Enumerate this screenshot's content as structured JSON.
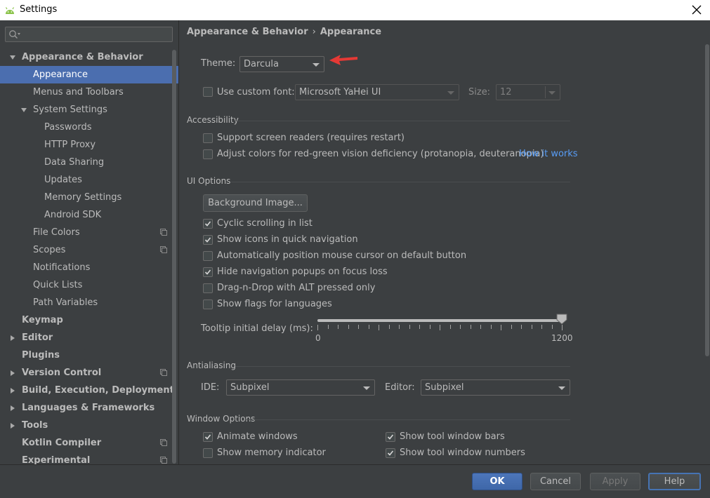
{
  "window": {
    "title": "Settings"
  },
  "sidebar": {
    "items": [
      {
        "label": "Appearance & Behavior",
        "level": 0,
        "bold": true,
        "expanded": true
      },
      {
        "label": "Appearance",
        "level": 1,
        "selected": true
      },
      {
        "label": "Menus and Toolbars",
        "level": 1
      },
      {
        "label": "System Settings",
        "level": 1,
        "expanded": true
      },
      {
        "label": "Passwords",
        "level": 2
      },
      {
        "label": "HTTP Proxy",
        "level": 2
      },
      {
        "label": "Data Sharing",
        "level": 2
      },
      {
        "label": "Updates",
        "level": 2
      },
      {
        "label": "Memory Settings",
        "level": 2
      },
      {
        "label": "Android SDK",
        "level": 2
      },
      {
        "label": "File Colors",
        "level": 1,
        "project_icon": true
      },
      {
        "label": "Scopes",
        "level": 1,
        "project_icon": true
      },
      {
        "label": "Notifications",
        "level": 1
      },
      {
        "label": "Quick Lists",
        "level": 1
      },
      {
        "label": "Path Variables",
        "level": 1
      },
      {
        "label": "Keymap",
        "level": 0,
        "bold": true
      },
      {
        "label": "Editor",
        "level": 0,
        "bold": true,
        "collapsed": true
      },
      {
        "label": "Plugins",
        "level": 0,
        "bold": true
      },
      {
        "label": "Version Control",
        "level": 0,
        "bold": true,
        "collapsed": true,
        "project_icon": true
      },
      {
        "label": "Build, Execution, Deployment",
        "level": 0,
        "bold": true,
        "collapsed": true
      },
      {
        "label": "Languages & Frameworks",
        "level": 0,
        "bold": true,
        "collapsed": true
      },
      {
        "label": "Tools",
        "level": 0,
        "bold": true,
        "collapsed": true
      },
      {
        "label": "Kotlin Compiler",
        "level": 0,
        "bold": true,
        "project_icon": true
      },
      {
        "label": "Experimental",
        "level": 0,
        "bold": true,
        "project_icon": true
      }
    ]
  },
  "breadcrumb": {
    "parent": "Appearance & Behavior",
    "separator": "›",
    "current": "Appearance"
  },
  "theme": {
    "label": "Theme:",
    "value": "Darcula"
  },
  "custom_font": {
    "label": "Use custom font:",
    "checked": false,
    "font_value": "Microsoft YaHei UI",
    "size_label": "Size:",
    "size_value": "12"
  },
  "accessibility": {
    "title": "Accessibility",
    "screen_readers": {
      "label": "Support screen readers (requires restart)",
      "checked": false
    },
    "color_adjust": {
      "label": "Adjust colors for red-green vision deficiency (protanopia, deuteranopia)",
      "checked": false
    },
    "how_it_works": "How it works"
  },
  "ui_options": {
    "title": "UI Options",
    "background_button": "Background Image...",
    "checkboxes": [
      {
        "label": "Cyclic scrolling in list",
        "checked": true
      },
      {
        "label": "Show icons in quick navigation",
        "checked": true
      },
      {
        "label": "Automatically position mouse cursor on default button",
        "checked": false
      },
      {
        "label": "Hide navigation popups on focus loss",
        "checked": true
      },
      {
        "label": "Drag-n-Drop with ALT pressed only",
        "checked": false
      },
      {
        "label": "Show flags for languages",
        "checked": false
      }
    ],
    "tooltip_delay": {
      "label": "Tooltip initial delay (ms):",
      "min": "0",
      "max": "1200",
      "value": 1200
    }
  },
  "antialiasing": {
    "title": "Antialiasing",
    "ide_label": "IDE:",
    "ide_value": "Subpixel",
    "editor_label": "Editor:",
    "editor_value": "Subpixel"
  },
  "window_options": {
    "title": "Window Options",
    "animate_windows": {
      "label": "Animate windows",
      "checked": true
    },
    "show_memory": {
      "label": "Show memory indicator",
      "checked": false
    },
    "tool_window_bars": {
      "label": "Show tool window bars",
      "checked": true
    },
    "tool_window_numbers": {
      "label": "Show tool window numbers",
      "checked": true
    }
  },
  "footer": {
    "ok": "OK",
    "cancel": "Cancel",
    "apply": "Apply",
    "help": "Help"
  },
  "colors": {
    "background": "#3c3f41",
    "selection": "#4b6eaf",
    "text": "#bbbbbb",
    "link": "#589df6",
    "annotation_arrow": "#e53935"
  }
}
